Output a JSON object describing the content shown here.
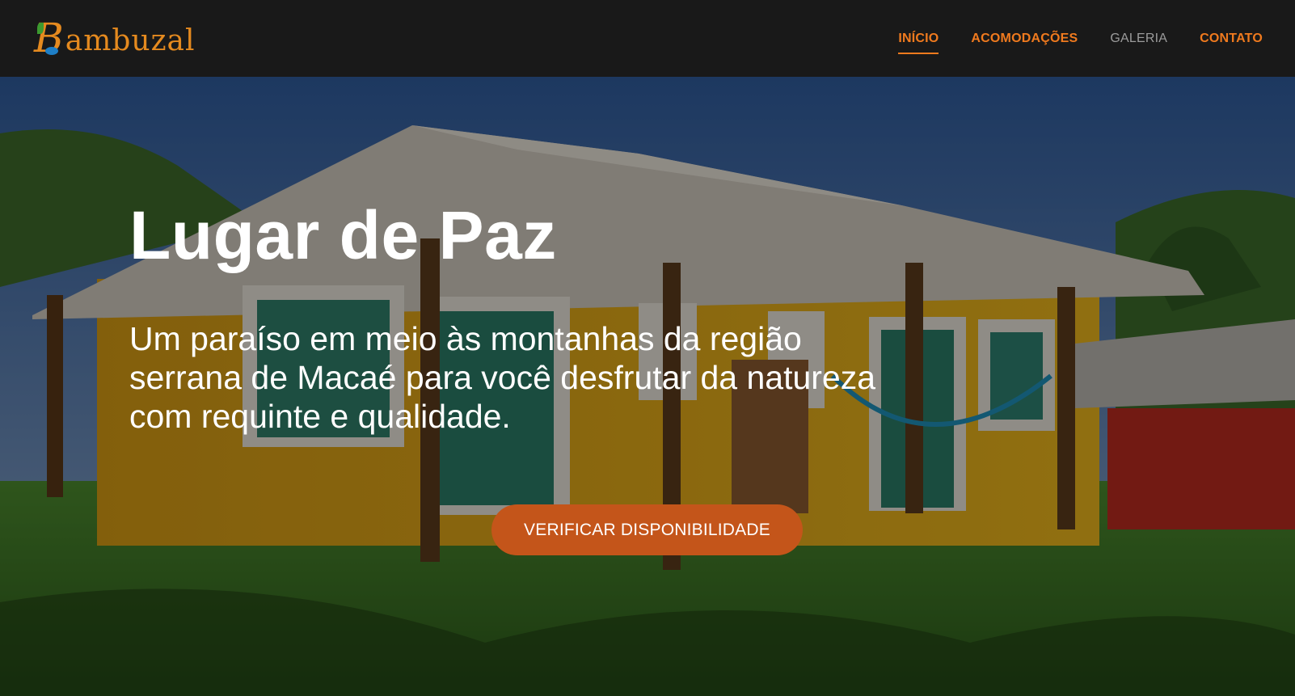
{
  "brand": {
    "logo_text": "Bambuzal",
    "colors": {
      "orange": "#f07a1e",
      "blue": "#1e7fc7",
      "green": "#3c9a2f"
    }
  },
  "nav": {
    "items": [
      {
        "label": "INÍCIO",
        "active": true
      },
      {
        "label": "ACOMODAÇÕES",
        "active": false
      },
      {
        "label": "GALERIA",
        "active": false
      },
      {
        "label": "CONTATO",
        "active": false
      }
    ]
  },
  "hero": {
    "title": "Lugar de Paz",
    "subtitle": "Um paraíso em meio às montanhas da região serrana de Macaé para você desfrutar da natureza com requinte e qualidade.",
    "cta_label": "VERIFICAR DISPONIBILIDADE",
    "cta_color": "#c4551a"
  }
}
